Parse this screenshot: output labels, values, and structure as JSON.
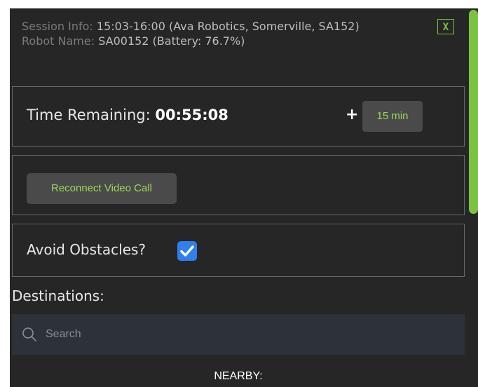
{
  "session": {
    "info_label": "Session Info:",
    "info_value": "15:03-16:00 (Ava Robotics, Somerville, SA152)",
    "robot_label": "Robot Name:",
    "robot_value": "SA00152 (Battery: 76.7%)",
    "close_label": "X"
  },
  "timer": {
    "label": "Time Remaining:",
    "value": "00:55:08",
    "plus": "+",
    "add_label": "15 min"
  },
  "video": {
    "reconnect_label": "Reconnect Video Call"
  },
  "obstacles": {
    "label": "Avoid Obstacles?",
    "checked": true
  },
  "destinations": {
    "label": "Destinations:",
    "search_placeholder": "Search",
    "nearby_label": "NEARBY:"
  },
  "colors": {
    "accent": "#7cc242",
    "panel_bg": "#262626",
    "checkbox": "#2f80ed",
    "search_bg": "#2d3138"
  },
  "icons": {
    "close": "close-icon",
    "check": "checkmark-icon",
    "search": "search-icon"
  }
}
